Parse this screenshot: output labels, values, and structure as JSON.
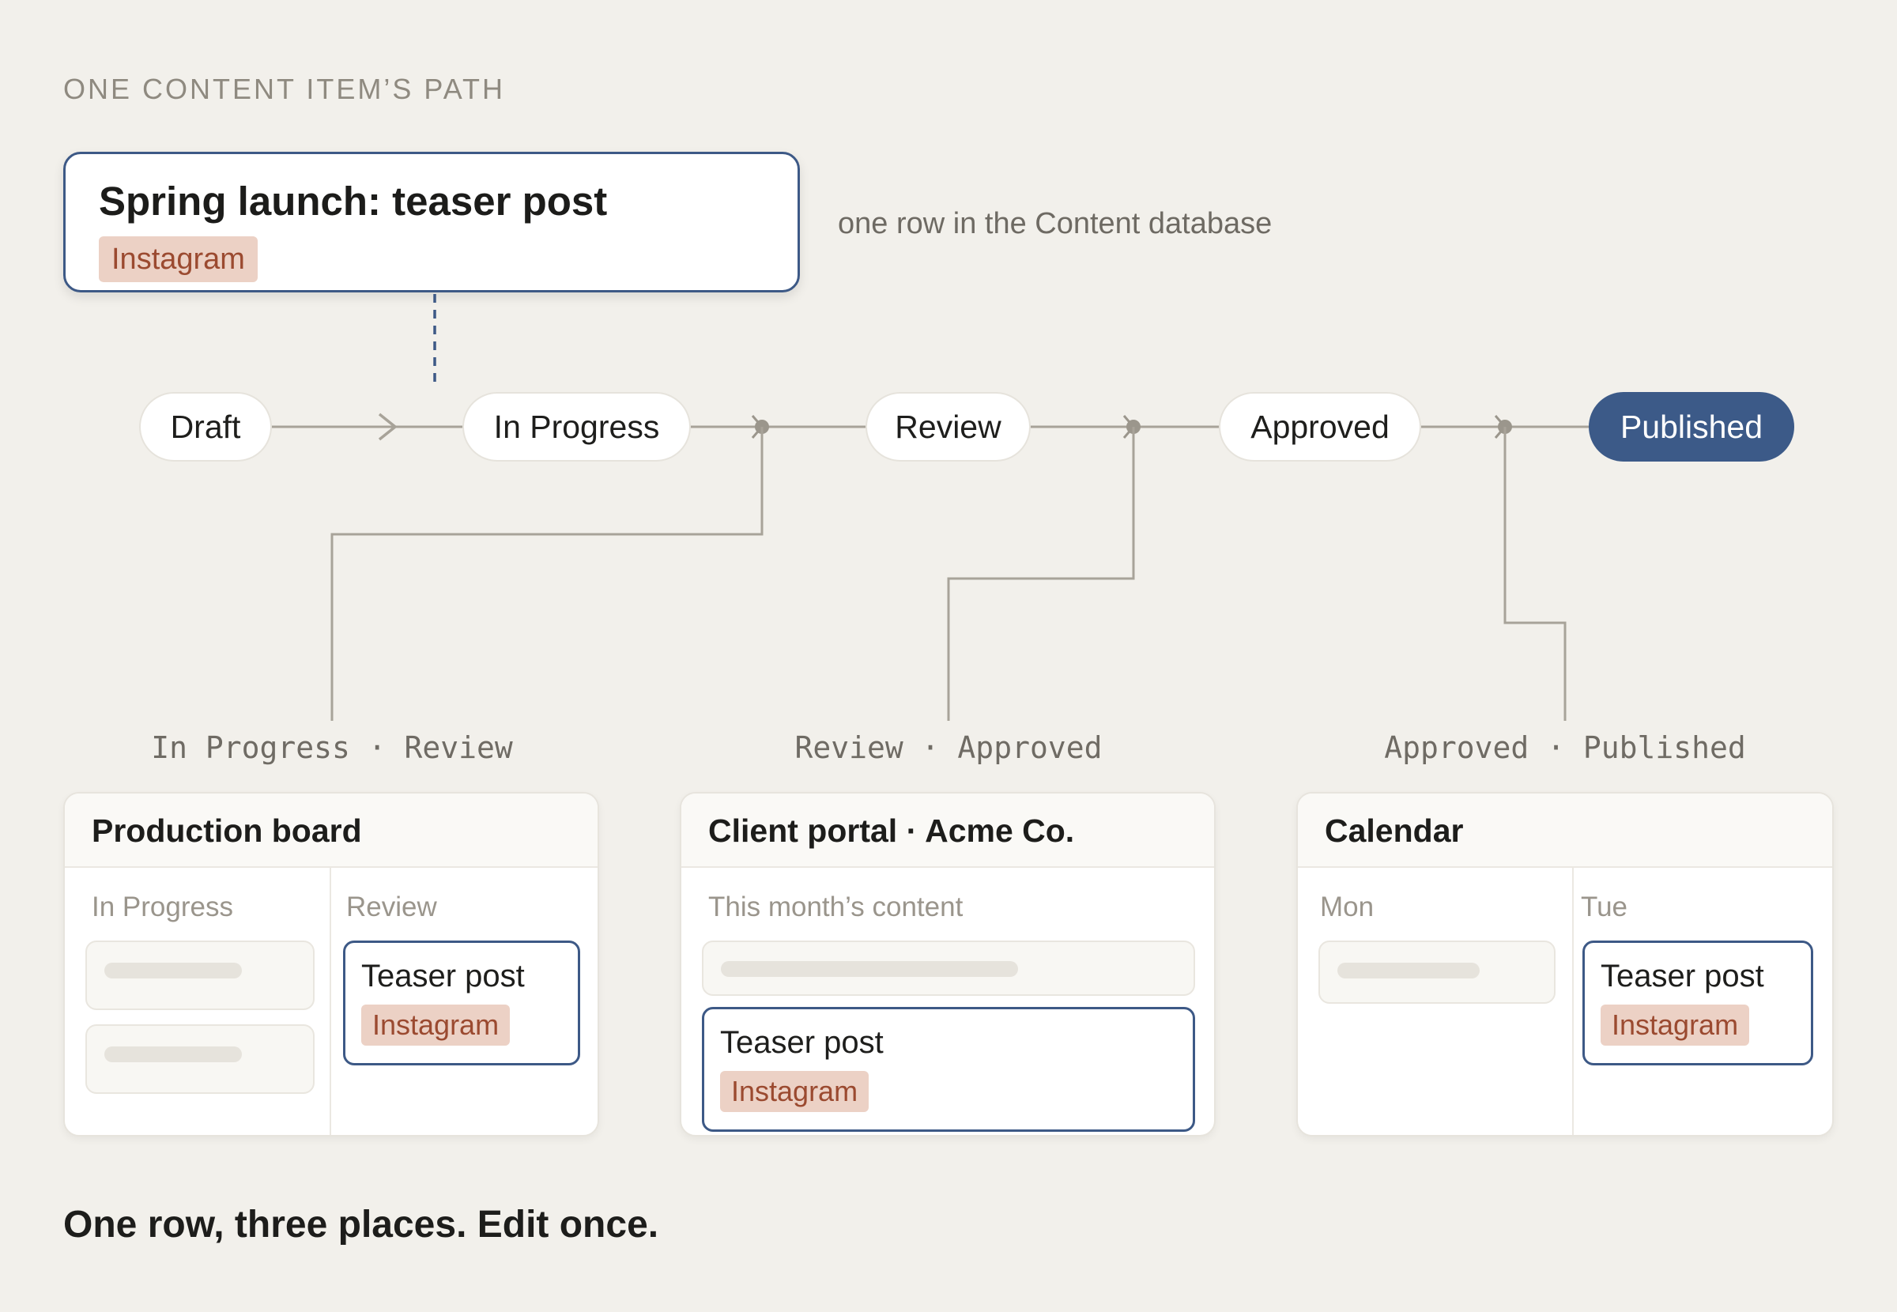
{
  "heading": "ONE CONTENT ITEM’S PATH",
  "item": {
    "title": "Spring launch: teaser post",
    "tag": "Instagram"
  },
  "item_note": "one row in the Content database",
  "stages": [
    "Draft",
    "In Progress",
    "Review",
    "Approved",
    "Published"
  ],
  "current_stage": "Published",
  "views": [
    {
      "transition": "In Progress · Review",
      "title": "Production board",
      "columns": [
        "In Progress",
        "Review"
      ],
      "card": {
        "title": "Teaser post",
        "tag": "Instagram"
      }
    },
    {
      "transition": "Review · Approved",
      "title": "Client portal · Acme Co.",
      "columns": [
        "This month’s content"
      ],
      "card": {
        "title": "Teaser post",
        "tag": "Instagram"
      }
    },
    {
      "transition": "Approved · Published",
      "title": "Calendar",
      "columns": [
        "Mon",
        "Tue"
      ],
      "card": {
        "title": "Teaser post",
        "tag": "Instagram"
      }
    }
  ],
  "footer": "One row, three places. Edit once.",
  "colors": {
    "accent": "#3c5a88",
    "tag_bg": "#ecd1c5",
    "tag_text": "#9b4a30",
    "line": "#a8a399",
    "background": "#f2f0eb"
  }
}
